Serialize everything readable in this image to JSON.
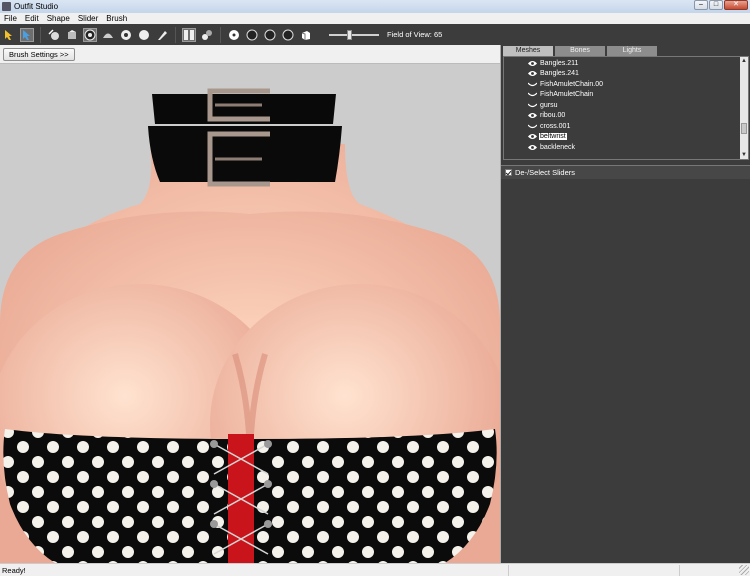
{
  "window": {
    "title": "Outfit Studio",
    "buttons": [
      "–",
      "□",
      "✕"
    ]
  },
  "menu": [
    "File",
    "Edit",
    "Shape",
    "Slider",
    "Brush"
  ],
  "toolbar": {
    "icons": [
      "select-tool-icon",
      "transform-tool-icon",
      "brush-inflate-icon",
      "brush-deflate-icon",
      "brush-move-icon",
      "brush-smooth-icon",
      "brush-mask-icon",
      "brush-unmask-icon",
      "brush-weight-icon",
      "brush-color-icon",
      "mirror-toggle-icon",
      "symmetry-toggle-icon",
      "view-front-icon",
      "view-back-icon",
      "view-left-icon",
      "view-right-icon",
      "perspective-icon"
    ],
    "fov_label": "Field of View: 65",
    "fov_value": 65
  },
  "viewport": {
    "brush_settings_label": "Brush Settings >>"
  },
  "tabs": [
    "Meshes",
    "Bones",
    "Lights"
  ],
  "active_tab": "Meshes",
  "meshes": [
    {
      "label": "Bangles.211",
      "icon": "eye-icon",
      "selected": false
    },
    {
      "label": "Bangles.241",
      "icon": "eye-icon",
      "selected": false
    },
    {
      "label": "FishAmuletChain.00",
      "icon": "eye-closed-icon",
      "selected": false
    },
    {
      "label": "FishAmuletChain",
      "icon": "eye-closed-icon",
      "selected": false
    },
    {
      "label": "gursu",
      "icon": "eye-closed-icon",
      "selected": false
    },
    {
      "label": "ribou.00",
      "icon": "eye-icon",
      "selected": false
    },
    {
      "label": "cross.001",
      "icon": "eye-closed-icon",
      "selected": false
    },
    {
      "label": "beltwrist",
      "icon": "eye-icon",
      "selected": true
    },
    {
      "label": "backleneck",
      "icon": "eye-icon",
      "selected": false
    }
  ],
  "sliders_panel": {
    "label": "De-/Select Sliders",
    "checked": true
  },
  "status": {
    "text": "Ready!"
  },
  "colors": {
    "toolbar_bg": "#3c3c3c",
    "panel_bg": "#3c3c3c",
    "viewport_bg": "#cccccc",
    "selection": "#ffffff"
  }
}
